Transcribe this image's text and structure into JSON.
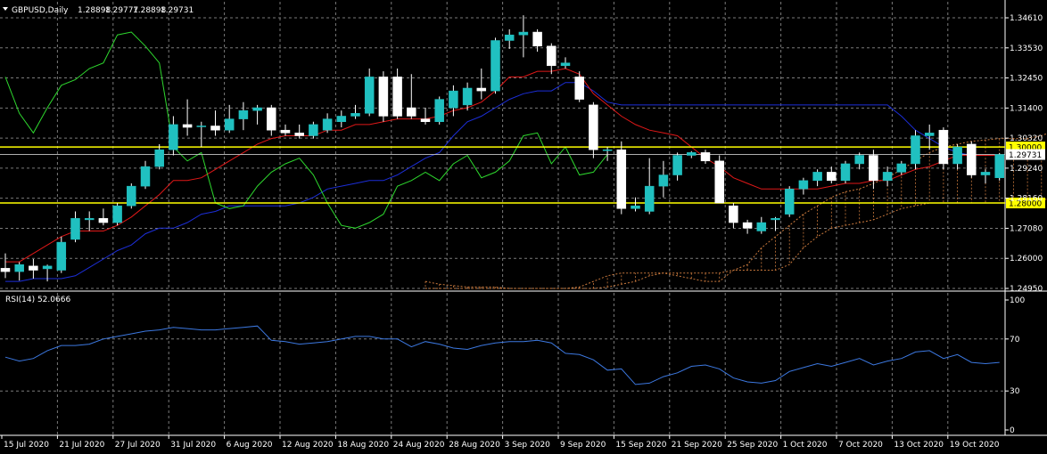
{
  "window": {
    "symbol_line": "GBPUSD,Daily",
    "ohlc": [
      "1.28898",
      "1.29777",
      "1.28898",
      "1.29731"
    ]
  },
  "rsi_label": "RSI(14) 52.0666",
  "colors": {
    "background": "#000000",
    "grid": "#7a7a7a",
    "bull_candle": "#20c0c0",
    "bear_candle": "#ffffff",
    "fast_line": "#e01818",
    "slow_line": "#1c2ed8",
    "lagging_line": "#2ed82e",
    "cloud": "#c8783c",
    "level_line": "#ffff00",
    "rsi_line": "#3c78e0",
    "price_tag": "#ffffff"
  },
  "chart_data": [
    {
      "type": "candlestick",
      "title": "GBPUSD,Daily",
      "price_axis": {
        "range": [
          1.2495,
          1.3461
        ],
        "ticks": [
          "1.34610",
          "1.33530",
          "1.32450",
          "1.31400",
          "1.30320",
          "1.29240",
          "1.28160",
          "1.27080",
          "1.26000",
          "1.24950"
        ]
      },
      "time_axis": {
        "labels": [
          "15 Jul 2020",
          "21 Jul 2020",
          "27 Jul 2020",
          "31 Jul 2020",
          "6 Aug 2020",
          "12 Aug 2020",
          "18 Aug 2020",
          "24 Aug 2020",
          "28 Aug 2020",
          "3 Sep 2020",
          "9 Sep 2020",
          "15 Sep 2020",
          "21 Sep 2020",
          "25 Sep 2020",
          "1 Oct 2020",
          "7 Oct 2020",
          "13 Oct 2020",
          "19 Oct 2020"
        ]
      },
      "candles": [
        {
          "o": 1.2567,
          "h": 1.262,
          "l": 1.2532,
          "c": 1.2555
        },
        {
          "o": 1.2555,
          "h": 1.2589,
          "l": 1.2523,
          "c": 1.258
        },
        {
          "o": 1.2575,
          "h": 1.26,
          "l": 1.253,
          "c": 1.256
        },
        {
          "o": 1.2565,
          "h": 1.258,
          "l": 1.252,
          "c": 1.2575
        },
        {
          "o": 1.256,
          "h": 1.268,
          "l": 1.255,
          "c": 1.266
        },
        {
          "o": 1.267,
          "h": 1.277,
          "l": 1.266,
          "c": 1.2745
        },
        {
          "o": 1.274,
          "h": 1.277,
          "l": 1.27,
          "c": 1.2745
        },
        {
          "o": 1.2745,
          "h": 1.278,
          "l": 1.272,
          "c": 1.273
        },
        {
          "o": 1.273,
          "h": 1.28,
          "l": 1.272,
          "c": 1.279
        },
        {
          "o": 1.279,
          "h": 1.287,
          "l": 1.278,
          "c": 1.286
        },
        {
          "o": 1.286,
          "h": 1.295,
          "l": 1.285,
          "c": 1.293
        },
        {
          "o": 1.293,
          "h": 1.301,
          "l": 1.292,
          "c": 1.299
        },
        {
          "o": 1.299,
          "h": 1.311,
          "l": 1.297,
          "c": 1.308
        },
        {
          "o": 1.308,
          "h": 1.317,
          "l": 1.304,
          "c": 1.307
        },
        {
          "o": 1.3075,
          "h": 1.309,
          "l": 1.3,
          "c": 1.3075
        },
        {
          "o": 1.3075,
          "h": 1.313,
          "l": 1.304,
          "c": 1.306
        },
        {
          "o": 1.306,
          "h": 1.315,
          "l": 1.305,
          "c": 1.31
        },
        {
          "o": 1.31,
          "h": 1.316,
          "l": 1.306,
          "c": 1.313
        },
        {
          "o": 1.313,
          "h": 1.315,
          "l": 1.308,
          "c": 1.314
        },
        {
          "o": 1.314,
          "h": 1.315,
          "l": 1.304,
          "c": 1.306
        },
        {
          "o": 1.306,
          "h": 1.308,
          "l": 1.304,
          "c": 1.305
        },
        {
          "o": 1.305,
          "h": 1.308,
          "l": 1.303,
          "c": 1.304
        },
        {
          "o": 1.304,
          "h": 1.309,
          "l": 1.303,
          "c": 1.308
        },
        {
          "o": 1.306,
          "h": 1.312,
          "l": 1.305,
          "c": 1.31
        },
        {
          "o": 1.309,
          "h": 1.313,
          "l": 1.307,
          "c": 1.311
        },
        {
          "o": 1.311,
          "h": 1.315,
          "l": 1.31,
          "c": 1.312
        },
        {
          "o": 1.312,
          "h": 1.328,
          "l": 1.311,
          "c": 1.325
        },
        {
          "o": 1.325,
          "h": 1.327,
          "l": 1.309,
          "c": 1.311
        },
        {
          "o": 1.325,
          "h": 1.328,
          "l": 1.31,
          "c": 1.311
        },
        {
          "o": 1.314,
          "h": 1.326,
          "l": 1.31,
          "c": 1.311
        },
        {
          "o": 1.31,
          "h": 1.314,
          "l": 1.308,
          "c": 1.309
        },
        {
          "o": 1.309,
          "h": 1.318,
          "l": 1.308,
          "c": 1.317
        },
        {
          "o": 1.314,
          "h": 1.322,
          "l": 1.311,
          "c": 1.32
        },
        {
          "o": 1.315,
          "h": 1.323,
          "l": 1.313,
          "c": 1.321
        },
        {
          "o": 1.321,
          "h": 1.328,
          "l": 1.317,
          "c": 1.32
        },
        {
          "o": 1.32,
          "h": 1.339,
          "l": 1.319,
          "c": 1.338
        },
        {
          "o": 1.338,
          "h": 1.342,
          "l": 1.335,
          "c": 1.34
        },
        {
          "o": 1.34,
          "h": 1.347,
          "l": 1.332,
          "c": 1.341
        },
        {
          "o": 1.341,
          "h": 1.342,
          "l": 1.334,
          "c": 1.336
        },
        {
          "o": 1.336,
          "h": 1.337,
          "l": 1.326,
          "c": 1.329
        },
        {
          "o": 1.329,
          "h": 1.332,
          "l": 1.328,
          "c": 1.33
        },
        {
          "o": 1.325,
          "h": 1.327,
          "l": 1.316,
          "c": 1.317
        },
        {
          "o": 1.315,
          "h": 1.316,
          "l": 1.296,
          "c": 1.299
        },
        {
          "o": 1.299,
          "h": 1.3,
          "l": 1.295,
          "c": 1.299
        },
        {
          "o": 1.299,
          "h": 1.302,
          "l": 1.276,
          "c": 1.278
        },
        {
          "o": 1.278,
          "h": 1.282,
          "l": 1.277,
          "c": 1.279
        },
        {
          "o": 1.277,
          "h": 1.296,
          "l": 1.276,
          "c": 1.286
        },
        {
          "o": 1.286,
          "h": 1.295,
          "l": 1.282,
          "c": 1.29
        },
        {
          "o": 1.29,
          "h": 1.298,
          "l": 1.288,
          "c": 1.297
        },
        {
          "o": 1.297,
          "h": 1.2985,
          "l": 1.296,
          "c": 1.298
        },
        {
          "o": 1.298,
          "h": 1.299,
          "l": 1.294,
          "c": 1.295
        },
        {
          "o": 1.295,
          "h": 1.297,
          "l": 1.28,
          "c": 1.28
        },
        {
          "o": 1.279,
          "h": 1.28,
          "l": 1.271,
          "c": 1.273
        },
        {
          "o": 1.273,
          "h": 1.274,
          "l": 1.269,
          "c": 1.271
        },
        {
          "o": 1.27,
          "h": 1.275,
          "l": 1.269,
          "c": 1.273
        },
        {
          "o": 1.274,
          "h": 1.275,
          "l": 1.27,
          "c": 1.2745
        },
        {
          "o": 1.276,
          "h": 1.286,
          "l": 1.275,
          "c": 1.285
        },
        {
          "o": 1.285,
          "h": 1.289,
          "l": 1.283,
          "c": 1.288
        },
        {
          "o": 1.288,
          "h": 1.292,
          "l": 1.286,
          "c": 1.291
        },
        {
          "o": 1.291,
          "h": 1.293,
          "l": 1.287,
          "c": 1.288
        },
        {
          "o": 1.288,
          "h": 1.295,
          "l": 1.287,
          "c": 1.294
        },
        {
          "o": 1.294,
          "h": 1.298,
          "l": 1.292,
          "c": 1.297
        },
        {
          "o": 1.297,
          "h": 1.299,
          "l": 1.285,
          "c": 1.288
        },
        {
          "o": 1.288,
          "h": 1.293,
          "l": 1.286,
          "c": 1.291
        },
        {
          "o": 1.291,
          "h": 1.295,
          "l": 1.29,
          "c": 1.294
        },
        {
          "o": 1.294,
          "h": 1.306,
          "l": 1.292,
          "c": 1.304
        },
        {
          "o": 1.304,
          "h": 1.308,
          "l": 1.299,
          "c": 1.305
        },
        {
          "o": 1.306,
          "h": 1.307,
          "l": 1.292,
          "c": 1.294
        },
        {
          "o": 1.294,
          "h": 1.301,
          "l": 1.292,
          "c": 1.3
        },
        {
          "o": 1.301,
          "h": 1.302,
          "l": 1.289,
          "c": 1.29
        },
        {
          "o": 1.29,
          "h": 1.292,
          "l": 1.287,
          "c": 1.291
        },
        {
          "o": 1.289,
          "h": 1.2978,
          "l": 1.288,
          "c": 1.2973
        }
      ],
      "tenkan": [
        1.259,
        1.259,
        1.262,
        1.265,
        1.268,
        1.27,
        1.27,
        1.27,
        1.272,
        1.275,
        1.279,
        1.283,
        1.288,
        1.288,
        1.289,
        1.292,
        1.295,
        1.298,
        1.301,
        1.303,
        1.304,
        1.304,
        1.304,
        1.306,
        1.306,
        1.308,
        1.308,
        1.309,
        1.31,
        1.31,
        1.31,
        1.311,
        1.313,
        1.314,
        1.316,
        1.32,
        1.325,
        1.325,
        1.327,
        1.327,
        1.328,
        1.326,
        1.319,
        1.315,
        1.311,
        1.308,
        1.306,
        1.305,
        1.304,
        1.3,
        1.296,
        1.293,
        1.289,
        1.287,
        1.285,
        1.285,
        1.285,
        1.285,
        1.285,
        1.286,
        1.287,
        1.287,
        1.288,
        1.288,
        1.29,
        1.292,
        1.293,
        1.295,
        1.297,
        1.297,
        1.297,
        1.297
      ],
      "kijun": [
        1.252,
        1.252,
        1.253,
        1.253,
        1.253,
        1.254,
        1.257,
        1.26,
        1.263,
        1.265,
        1.269,
        1.271,
        1.271,
        1.273,
        1.276,
        1.277,
        1.279,
        1.279,
        1.279,
        1.279,
        1.279,
        1.28,
        1.282,
        1.285,
        1.286,
        1.287,
        1.288,
        1.288,
        1.29,
        1.293,
        1.296,
        1.298,
        1.304,
        1.309,
        1.311,
        1.314,
        1.317,
        1.319,
        1.32,
        1.32,
        1.323,
        1.323,
        1.32,
        1.316,
        1.315,
        1.315,
        1.315,
        1.315,
        1.315,
        1.315,
        1.315,
        1.315,
        1.315,
        1.315,
        1.315,
        1.315,
        1.315,
        1.315,
        1.315,
        1.315,
        1.315,
        1.315,
        1.315,
        1.315,
        1.311,
        1.306,
        1.303,
        1.3,
        1.298,
        1.297,
        1.297,
        1.297
      ],
      "chikou": [
        1.325,
        1.312,
        1.305,
        1.314,
        1.322,
        1.324,
        1.328,
        1.33,
        1.34,
        1.341,
        1.336,
        1.33,
        1.3,
        1.295,
        1.298,
        1.28,
        1.278,
        1.279,
        1.286,
        1.291,
        1.294,
        1.296,
        1.29,
        1.28,
        1.272,
        1.271,
        1.273,
        1.276,
        1.286,
        1.288,
        1.291,
        1.288,
        1.294,
        1.297,
        1.289,
        1.291,
        1.295,
        1.304,
        1.305,
        1.294,
        1.3,
        1.29,
        1.291,
        1.2973
      ],
      "span_a": [
        1.252,
        1.251,
        1.2505,
        1.25,
        1.25,
        1.25,
        1.2495,
        1.2495,
        1.2495,
        1.2495,
        1.2495,
        1.2495,
        1.2495,
        1.25,
        1.251,
        1.252,
        1.254,
        1.255,
        1.255,
        1.255,
        1.255,
        1.255,
        1.256,
        1.258,
        1.264,
        1.268,
        1.272,
        1.276,
        1.279,
        1.282,
        1.284,
        1.285,
        1.287,
        1.289,
        1.292,
        1.295,
        1.298,
        1.3,
        1.301,
        1.302,
        1.3025,
        1.303,
        1.303,
        1.303,
        1.304,
        1.306,
        1.308,
        1.31,
        1.314,
        1.318,
        1.322,
        1.324,
        1.325,
        1.326,
        1.326,
        1.326,
        1.327,
        1.328,
        1.327,
        1.324,
        1.32,
        1.316,
        1.314,
        1.314,
        1.313,
        1.312,
        1.311,
        1.31
      ],
      "span_b": [
        1.2495,
        1.2495,
        1.2495,
        1.2495,
        1.2495,
        1.2495,
        1.2495,
        1.2495,
        1.2495,
        1.2495,
        1.2495,
        1.25,
        1.252,
        1.254,
        1.255,
        1.255,
        1.255,
        1.255,
        1.254,
        1.253,
        1.252,
        1.252,
        1.256,
        1.256,
        1.256,
        1.256,
        1.258,
        1.264,
        1.268,
        1.271,
        1.272,
        1.273,
        1.274,
        1.276,
        1.278,
        1.279,
        1.28,
        1.28,
        1.28,
        1.28,
        1.28,
        1.28,
        1.28,
        1.28,
        1.281,
        1.282,
        1.282,
        1.284,
        1.285,
        1.285,
        1.285,
        1.285,
        1.286,
        1.287,
        1.288,
        1.29,
        1.291,
        1.293,
        1.294,
        1.296,
        1.298,
        1.3,
        1.301,
        1.302,
        1.303,
        1.304,
        1.305,
        1.306
      ],
      "horizontal_levels": [
        {
          "value": 1.3,
          "label": "1.30000"
        },
        {
          "value": 1.28,
          "label": "1.28000"
        }
      ],
      "current_price": {
        "value": 1.29731,
        "label": "1.29731"
      }
    },
    {
      "type": "line",
      "title": "RSI(14) 52.0666",
      "y_ticks": [
        "100",
        "70",
        "30",
        "0"
      ],
      "ylim": [
        0,
        100
      ],
      "values": [
        56,
        53,
        55,
        61,
        65,
        65,
        66,
        70,
        72,
        74,
        76,
        77,
        79,
        78,
        77,
        77,
        78,
        79,
        80,
        69,
        68,
        66,
        67,
        68,
        70,
        72,
        72,
        70,
        70,
        64,
        68,
        66,
        63,
        62,
        65,
        67,
        68,
        68,
        69,
        67,
        59,
        58,
        54,
        46,
        47,
        35,
        36,
        41,
        44,
        49,
        50,
        47,
        40,
        37,
        36,
        38,
        45,
        48,
        51,
        49,
        52,
        55,
        50,
        53,
        55,
        60,
        61,
        55,
        58,
        52,
        51,
        52
      ]
    }
  ]
}
